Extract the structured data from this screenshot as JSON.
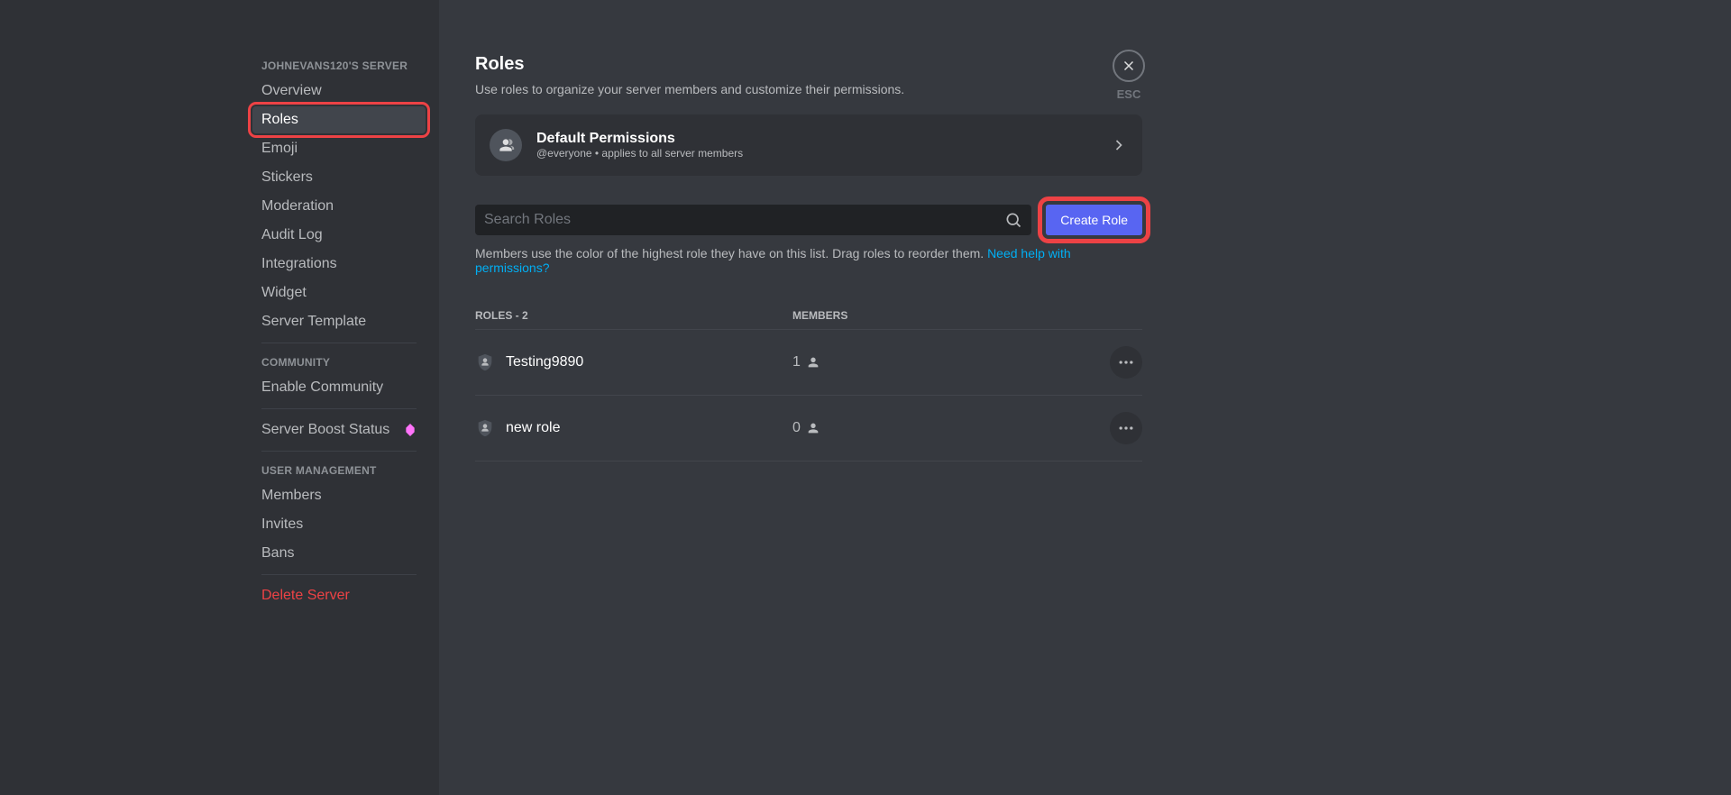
{
  "sidebar": {
    "server_name_header": "JOHNEVANS120'S SERVER",
    "items_main": [
      {
        "label": "Overview"
      },
      {
        "label": "Roles"
      },
      {
        "label": "Emoji"
      },
      {
        "label": "Stickers"
      },
      {
        "label": "Moderation"
      },
      {
        "label": "Audit Log"
      },
      {
        "label": "Integrations"
      },
      {
        "label": "Widget"
      },
      {
        "label": "Server Template"
      }
    ],
    "community_header": "COMMUNITY",
    "enable_community": "Enable Community",
    "boost_status": "Server Boost Status",
    "user_mgmt_header": "USER MANAGEMENT",
    "items_user": [
      {
        "label": "Members"
      },
      {
        "label": "Invites"
      },
      {
        "label": "Bans"
      }
    ],
    "delete_server": "Delete Server"
  },
  "main": {
    "title": "Roles",
    "description": "Use roles to organize your server members and customize their permissions.",
    "default_perms": {
      "title": "Default Permissions",
      "subtitle": "@everyone • applies to all server members"
    },
    "search_placeholder": "Search Roles",
    "create_role_btn": "Create Role",
    "hint_text": "Members use the color of the highest role they have on this list. Drag roles to reorder them. ",
    "hint_link": "Need help with permissions?",
    "table": {
      "roles_header": "ROLES - 2",
      "members_header": "MEMBERS"
    },
    "roles": [
      {
        "name": "Testing9890",
        "members": "1"
      },
      {
        "name": "new role",
        "members": "0"
      }
    ]
  },
  "close": {
    "label": "ESC"
  }
}
